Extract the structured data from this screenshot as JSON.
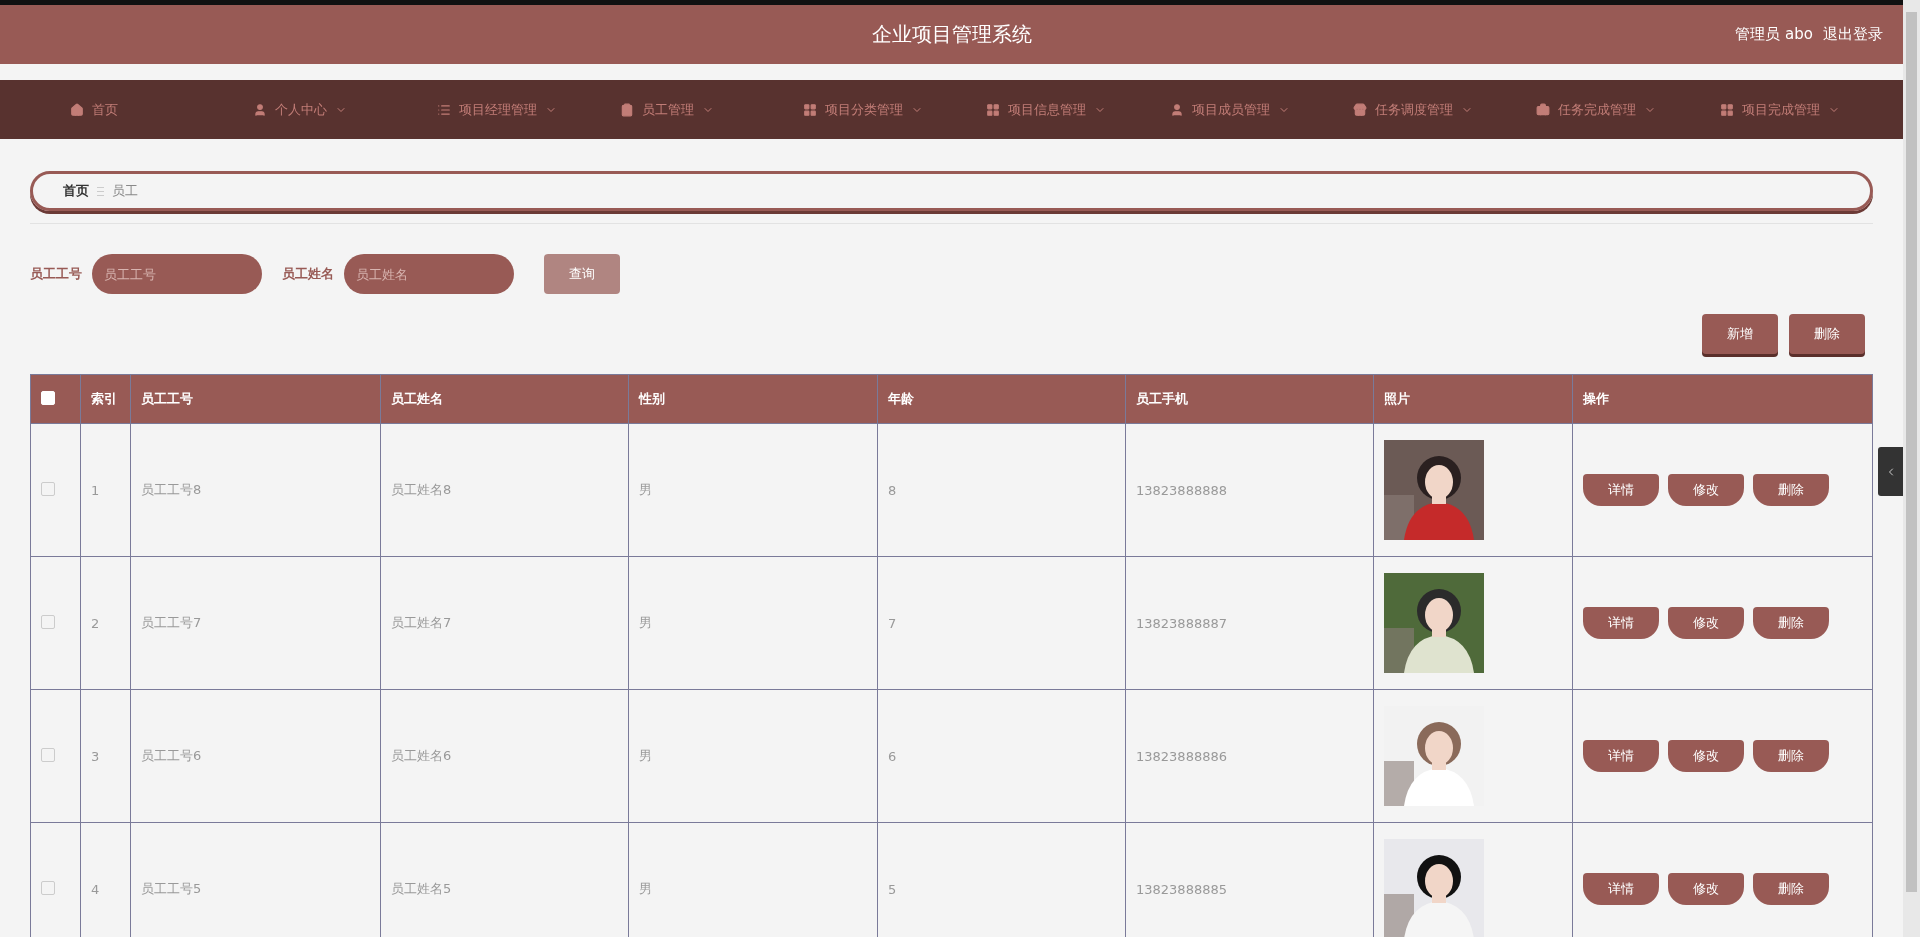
{
  "header": {
    "title": "企业项目管理系统",
    "user": "管理员 abo",
    "logout": "退出登录"
  },
  "nav": [
    {
      "label": "首页",
      "has_menu": false
    },
    {
      "label": "个人中心",
      "has_menu": true
    },
    {
      "label": "项目经理管理",
      "has_menu": true
    },
    {
      "label": "员工管理",
      "has_menu": true
    },
    {
      "label": "项目分类管理",
      "has_menu": true
    },
    {
      "label": "项目信息管理",
      "has_menu": true
    },
    {
      "label": "项目成员管理",
      "has_menu": true
    },
    {
      "label": "任务调度管理",
      "has_menu": true
    },
    {
      "label": "任务完成管理",
      "has_menu": true
    },
    {
      "label": "项目完成管理",
      "has_menu": true
    }
  ],
  "breadcrumb": [
    "首页",
    "员工"
  ],
  "filters": [
    {
      "label": "员工工号",
      "placeholder": "员工工号"
    },
    {
      "label": "员工姓名",
      "placeholder": "员工姓名"
    }
  ],
  "search_button": "查询",
  "toolbar": [
    "新增",
    "删除"
  ],
  "table": {
    "select_all_checked": false,
    "columns": [
      "索引",
      "员工工号",
      "员工姓名",
      "性别",
      "年龄",
      "员工手机",
      "照片",
      "操作"
    ],
    "rows": [
      {
        "checked": false,
        "cells": [
          "1",
          "员工工号8",
          "员工姓名8",
          "男",
          "8",
          "13823888888"
        ],
        "photo": {
          "kind": "picture"
        },
        "actions": [
          "详情",
          "修改",
          "删除"
        ]
      },
      {
        "checked": false,
        "cells": [
          "2",
          "员工工号7",
          "员工姓名7",
          "男",
          "7",
          "13823888887"
        ],
        "photo": {
          "kind": "picture"
        },
        "actions": [
          "详情",
          "修改",
          "删除"
        ]
      },
      {
        "checked": false,
        "cells": [
          "3",
          "员工工号6",
          "员工姓名6",
          "男",
          "6",
          "13823888886"
        ],
        "photo": {
          "kind": "picture"
        },
        "actions": [
          "详情",
          "修改",
          "删除"
        ]
      },
      {
        "checked": false,
        "cells": [
          "4",
          "员工工号5",
          "员工姓名5",
          "男",
          "5",
          "13823888885"
        ],
        "photo": {
          "kind": "picture"
        },
        "actions": [
          "详情",
          "修改",
          "删除"
        ]
      }
    ]
  }
}
